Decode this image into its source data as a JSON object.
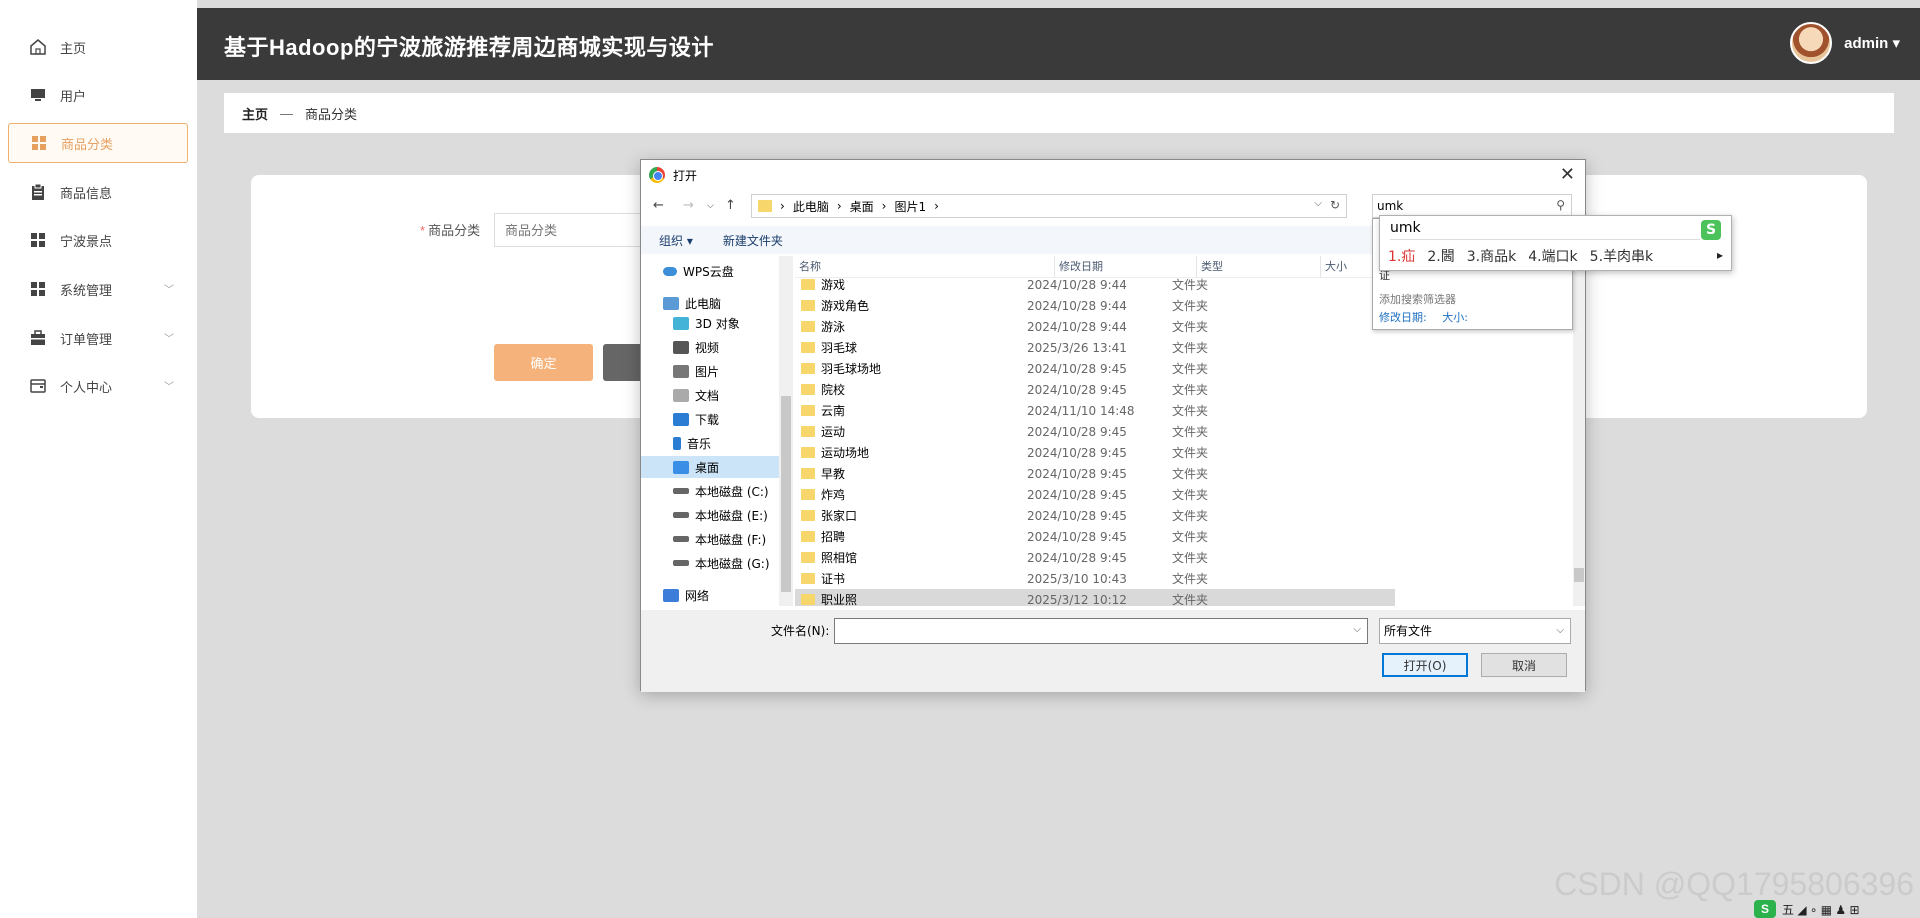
{
  "sidebar": {
    "items": [
      {
        "label": "主页",
        "icon": "home-icon"
      },
      {
        "label": "用户",
        "icon": "monitor-icon"
      },
      {
        "label": "商品分类",
        "icon": "grid-icon"
      },
      {
        "label": "商品信息",
        "icon": "clipboard-icon"
      },
      {
        "label": "宁波景点",
        "icon": "grid-icon"
      },
      {
        "label": "系统管理",
        "icon": "grid-icon"
      },
      {
        "label": "订单管理",
        "icon": "briefcase-icon"
      },
      {
        "label": "个人中心",
        "icon": "wallet-icon"
      }
    ]
  },
  "header": {
    "title": "基于Hadoop的宁波旅游推荐周边商城实现与设计",
    "user": "admin ▾"
  },
  "breadcrumb": {
    "home": "主页",
    "sep": "—",
    "current": "商品分类"
  },
  "form": {
    "label": "商品分类",
    "placeholder": "商品分类",
    "ok_label": "确定"
  },
  "dialog": {
    "title": "打开",
    "path": [
      "此电脑",
      "桌面",
      "图片1"
    ],
    "search_value": "umk",
    "toolbar": {
      "organize": "组织 ▾",
      "new_folder": "新建文件夹"
    },
    "nav_items": [
      {
        "label": "WPS云盘",
        "color": "#3b8fd9"
      },
      {
        "label": "此电脑",
        "color": "#5a9bd5"
      },
      {
        "label": "3D 对象",
        "color": "#43b4d8"
      },
      {
        "label": "视频",
        "color": "#555555"
      },
      {
        "label": "图片",
        "color": "#777777"
      },
      {
        "label": "文档",
        "color": "#888888"
      },
      {
        "label": "下载",
        "color": "#2b7cd3"
      },
      {
        "label": "音乐",
        "color": "#2b7cd3"
      },
      {
        "label": "桌面",
        "color": "#3a8ee6"
      },
      {
        "label": "本地磁盘 (C:)",
        "color": "#666666"
      },
      {
        "label": "本地磁盘 (E:)",
        "color": "#666666"
      },
      {
        "label": "本地磁盘 (F:)",
        "color": "#666666"
      },
      {
        "label": "本地磁盘 (G:)",
        "color": "#666666"
      },
      {
        "label": "网络",
        "color": "#3b7dd8"
      }
    ],
    "columns": [
      "名称",
      "修改日期",
      "类型",
      "大小"
    ],
    "files": [
      {
        "name": "游戏",
        "date": "2024/10/28 9:44",
        "type": "文件夹"
      },
      {
        "name": "游戏角色",
        "date": "2024/10/28 9:44",
        "type": "文件夹"
      },
      {
        "name": "游泳",
        "date": "2024/10/28 9:44",
        "type": "文件夹"
      },
      {
        "name": "羽毛球",
        "date": "2025/3/26 13:41",
        "type": "文件夹"
      },
      {
        "name": "羽毛球场地",
        "date": "2024/10/28 9:45",
        "type": "文件夹"
      },
      {
        "name": "院校",
        "date": "2024/10/28 9:45",
        "type": "文件夹"
      },
      {
        "name": "云南",
        "date": "2024/11/10 14:48",
        "type": "文件夹"
      },
      {
        "name": "运动",
        "date": "2024/10/28 9:45",
        "type": "文件夹"
      },
      {
        "name": "运动场地",
        "date": "2024/10/28 9:45",
        "type": "文件夹"
      },
      {
        "name": "早教",
        "date": "2024/10/28 9:45",
        "type": "文件夹"
      },
      {
        "name": "炸鸡",
        "date": "2024/10/28 9:45",
        "type": "文件夹"
      },
      {
        "name": "张家口",
        "date": "2024/10/28 9:45",
        "type": "文件夹"
      },
      {
        "name": "招聘",
        "date": "2024/10/28 9:45",
        "type": "文件夹"
      },
      {
        "name": "照相馆",
        "date": "2024/10/28 9:45",
        "type": "文件夹"
      },
      {
        "name": "证书",
        "date": "2025/3/10 10:43",
        "type": "文件夹"
      },
      {
        "name": "职业照",
        "date": "2025/3/12 10:12",
        "type": "文件夹"
      }
    ],
    "filename_label": "文件名(N):",
    "filetype": "所有文件",
    "open_label": "打开(O)",
    "cancel_label": "取消"
  },
  "search_dropdown": {
    "partial": "证",
    "hint": "添加搜索筛选器",
    "filters": [
      "修改日期:",
      "大小:"
    ]
  },
  "ime": {
    "composition": "umk",
    "candidates": [
      "1.疝",
      "2.閪",
      "3.商品k",
      "4.端口k",
      "5.羊肉串k"
    ],
    "logo": "S"
  },
  "watermark": "CSDN @QQ1795806396",
  "tray": {
    "text": "五 ◢ ∘ ▦ ♟ ⊞"
  }
}
